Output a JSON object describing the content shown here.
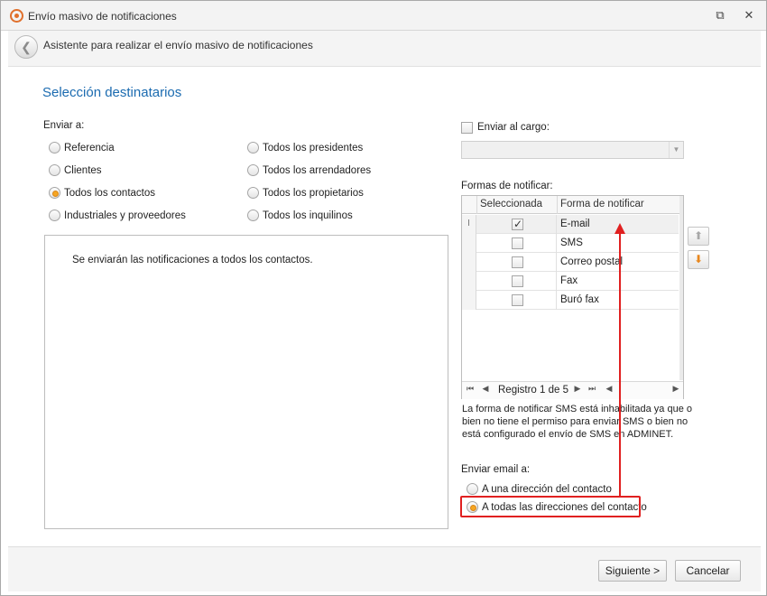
{
  "window": {
    "title": "Envío masivo de notificaciones",
    "restore_glyph": "⧉",
    "close_glyph": "✕"
  },
  "wizard": {
    "back_glyph": "❮",
    "title": "Asistente para realizar el envío masivo de notificaciones"
  },
  "section_title": "Selección destinatarios",
  "send_to": {
    "label": "Enviar a:",
    "options": [
      {
        "label": "Referencia",
        "checked": false
      },
      {
        "label": "Clientes",
        "checked": false
      },
      {
        "label": "Todos los contactos",
        "checked": true
      },
      {
        "label": "Industriales y proveedores",
        "checked": false
      },
      {
        "label": "Todos los presidentes",
        "checked": false
      },
      {
        "label": "Todos los arrendadores",
        "checked": false
      },
      {
        "label": "Todos los propietarios",
        "checked": false
      },
      {
        "label": "Todos los inquilinos",
        "checked": false
      }
    ]
  },
  "info_message": "Se enviarán las notificaciones a todos los contactos.",
  "send_to_position": {
    "label": "Enviar al cargo:",
    "checked": false,
    "combo_value": "",
    "combo_arrow": "▼"
  },
  "notify_forms": {
    "label": "Formas de notificar:",
    "columns": [
      "Seleccionada",
      "Forma de notificar"
    ],
    "rows": [
      {
        "selected": true,
        "form": "E-mail",
        "indicator": "I"
      },
      {
        "selected": false,
        "form": "SMS",
        "indicator": ""
      },
      {
        "selected": false,
        "form": "Correo postal",
        "indicator": ""
      },
      {
        "selected": false,
        "form": "Fax",
        "indicator": ""
      },
      {
        "selected": false,
        "form": "Buró fax",
        "indicator": ""
      }
    ],
    "navigator": {
      "first": "⏮",
      "prev": "◀",
      "text": "Registro 1 de 5",
      "next": "▶",
      "last": "⏭",
      "scroll_left": "◀",
      "scroll_right": "▶"
    },
    "move_up_glyph": "⬆",
    "move_down_glyph": "⬇"
  },
  "sms_note": "La forma de notificar SMS está inhabilitada ya que o bien no tiene el permiso para enviar SMS o bien no está configurado el envío de SMS en ADMINET.",
  "email_to": {
    "label": "Enviar email a:",
    "options": [
      {
        "label": "A una dirección del contacto",
        "checked": false
      },
      {
        "label": "A todas las direcciones del contacto",
        "checked": true
      }
    ]
  },
  "colors": {
    "accent_blue": "#1b6bb0",
    "highlight_red": "#e02020",
    "radio_selected": "#f5a623",
    "move_down_orange": "#e8871e"
  },
  "footer": {
    "next_label": "Siguiente >",
    "cancel_label": "Cancelar"
  }
}
